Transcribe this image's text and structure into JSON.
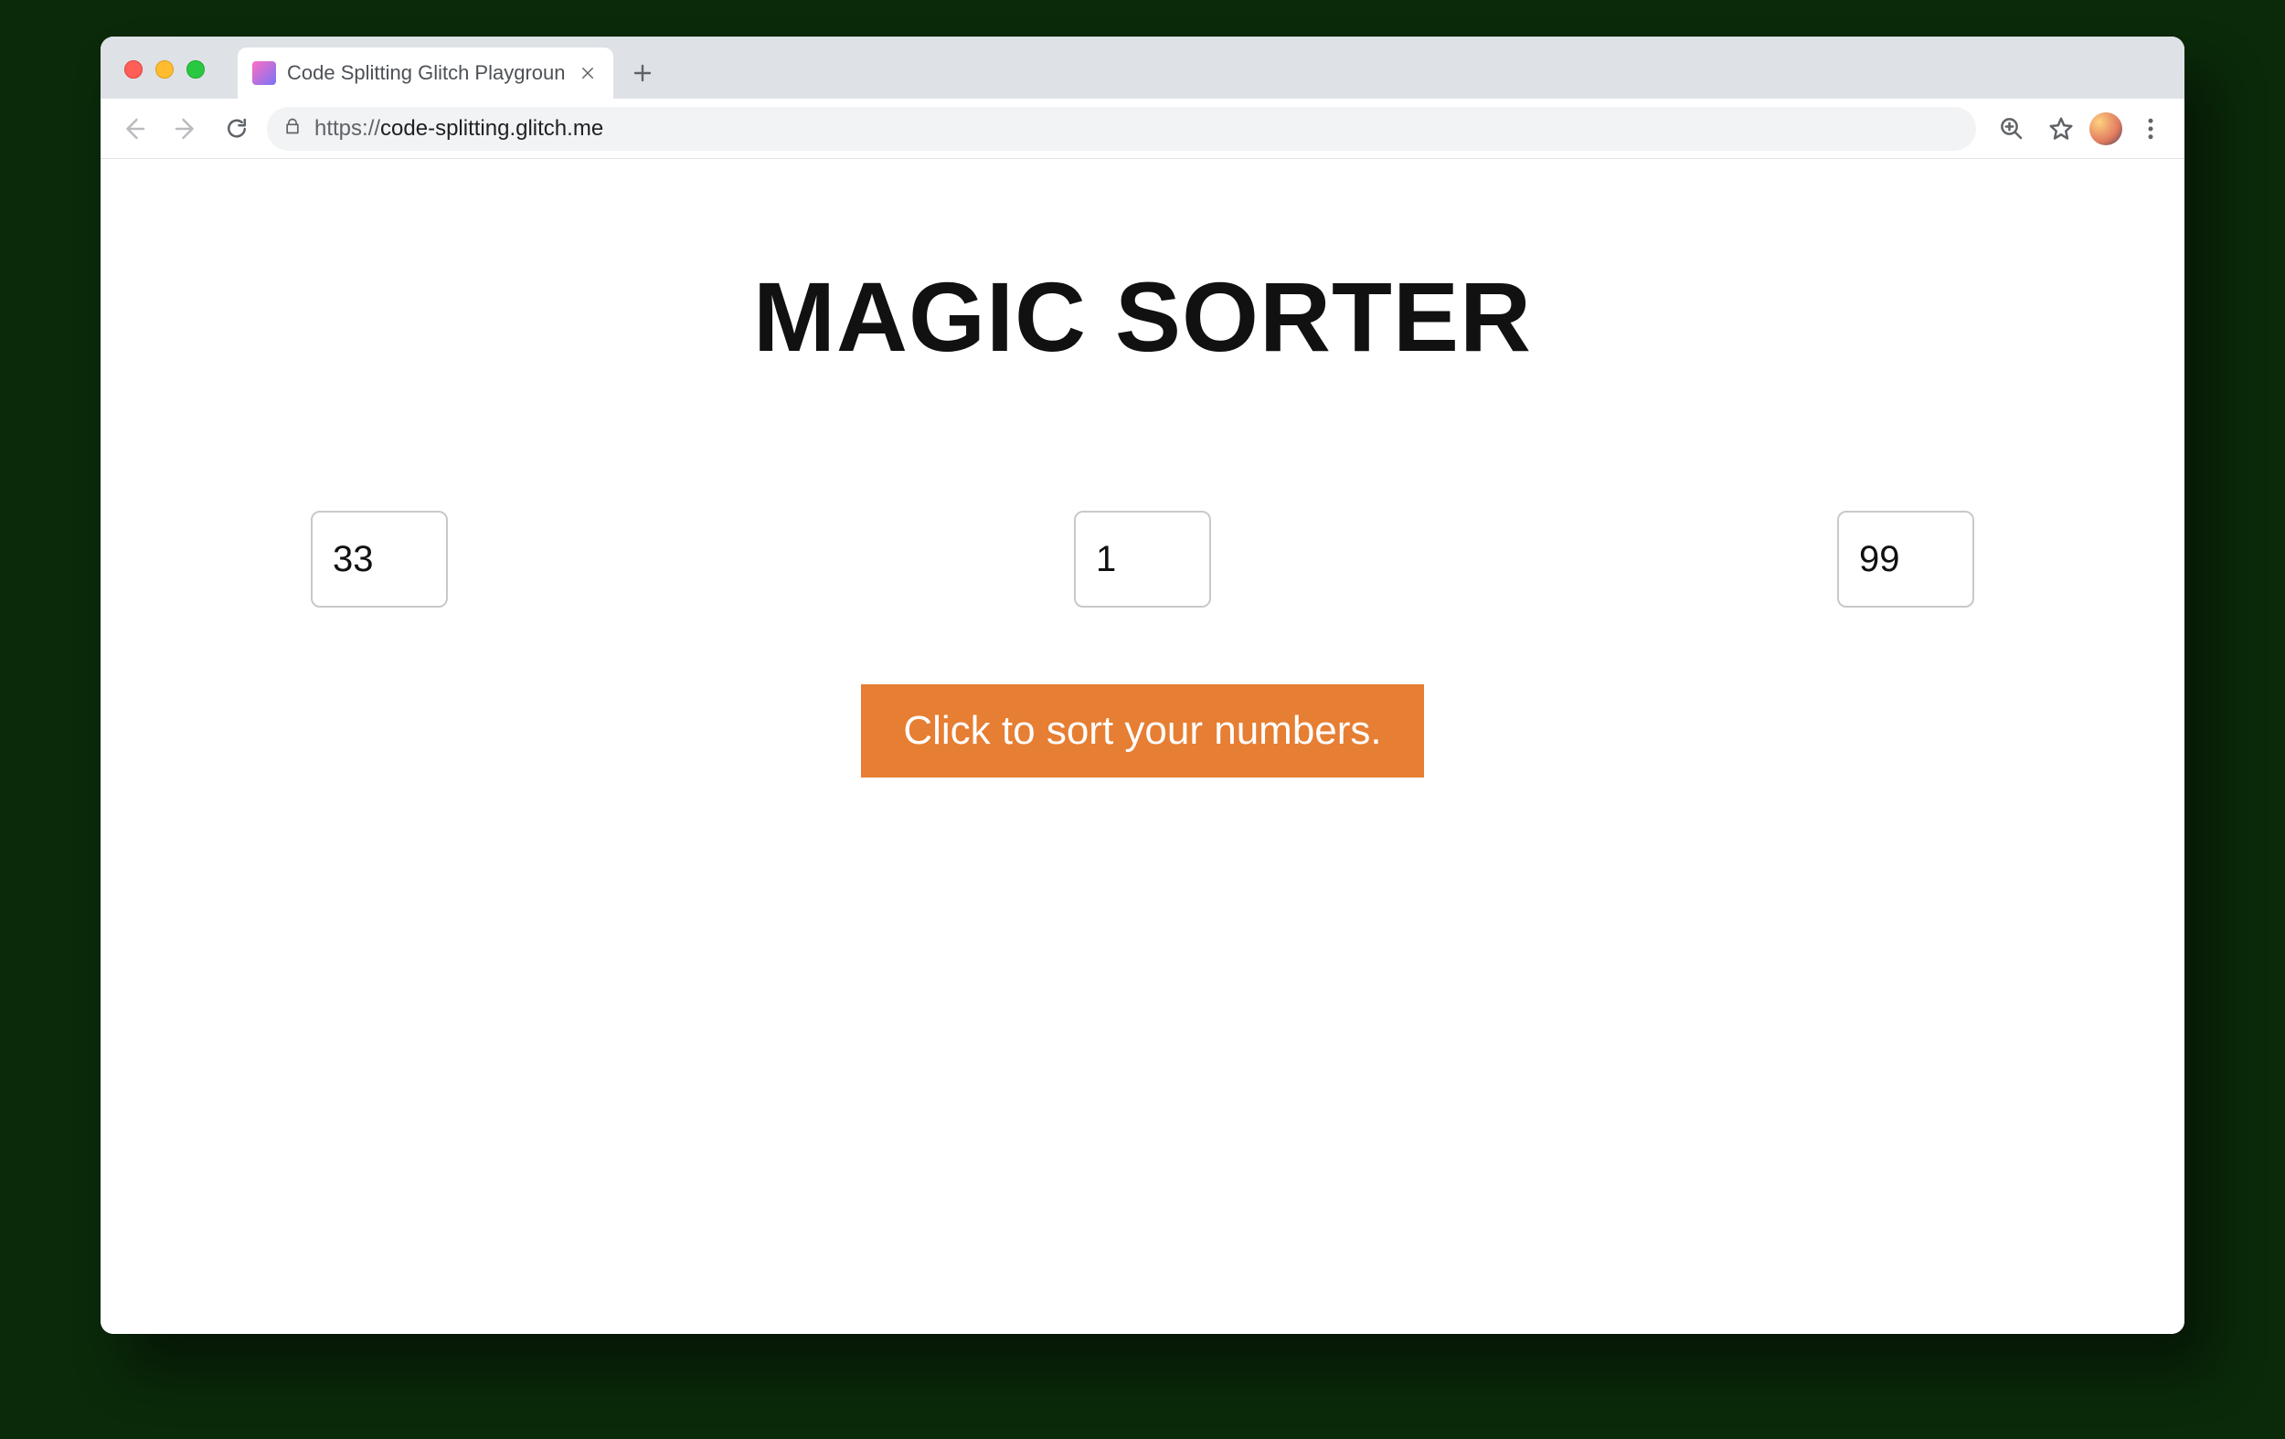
{
  "window": {
    "traffic_lights": [
      "close",
      "minimize",
      "zoom"
    ]
  },
  "tab": {
    "title": "Code Splitting Glitch Playground",
    "truncated_title": "Code Splitting Glitch Playgroun"
  },
  "address": {
    "scheme": "https://",
    "hostpath": "code-splitting.glitch.me",
    "full": "https://code-splitting.glitch.me"
  },
  "page": {
    "heading": "MAGIC SORTER",
    "inputs": [
      "33",
      "1",
      "99"
    ],
    "sort_button_label": "Click to sort your numbers."
  },
  "colors": {
    "accent": "#e67e33"
  }
}
